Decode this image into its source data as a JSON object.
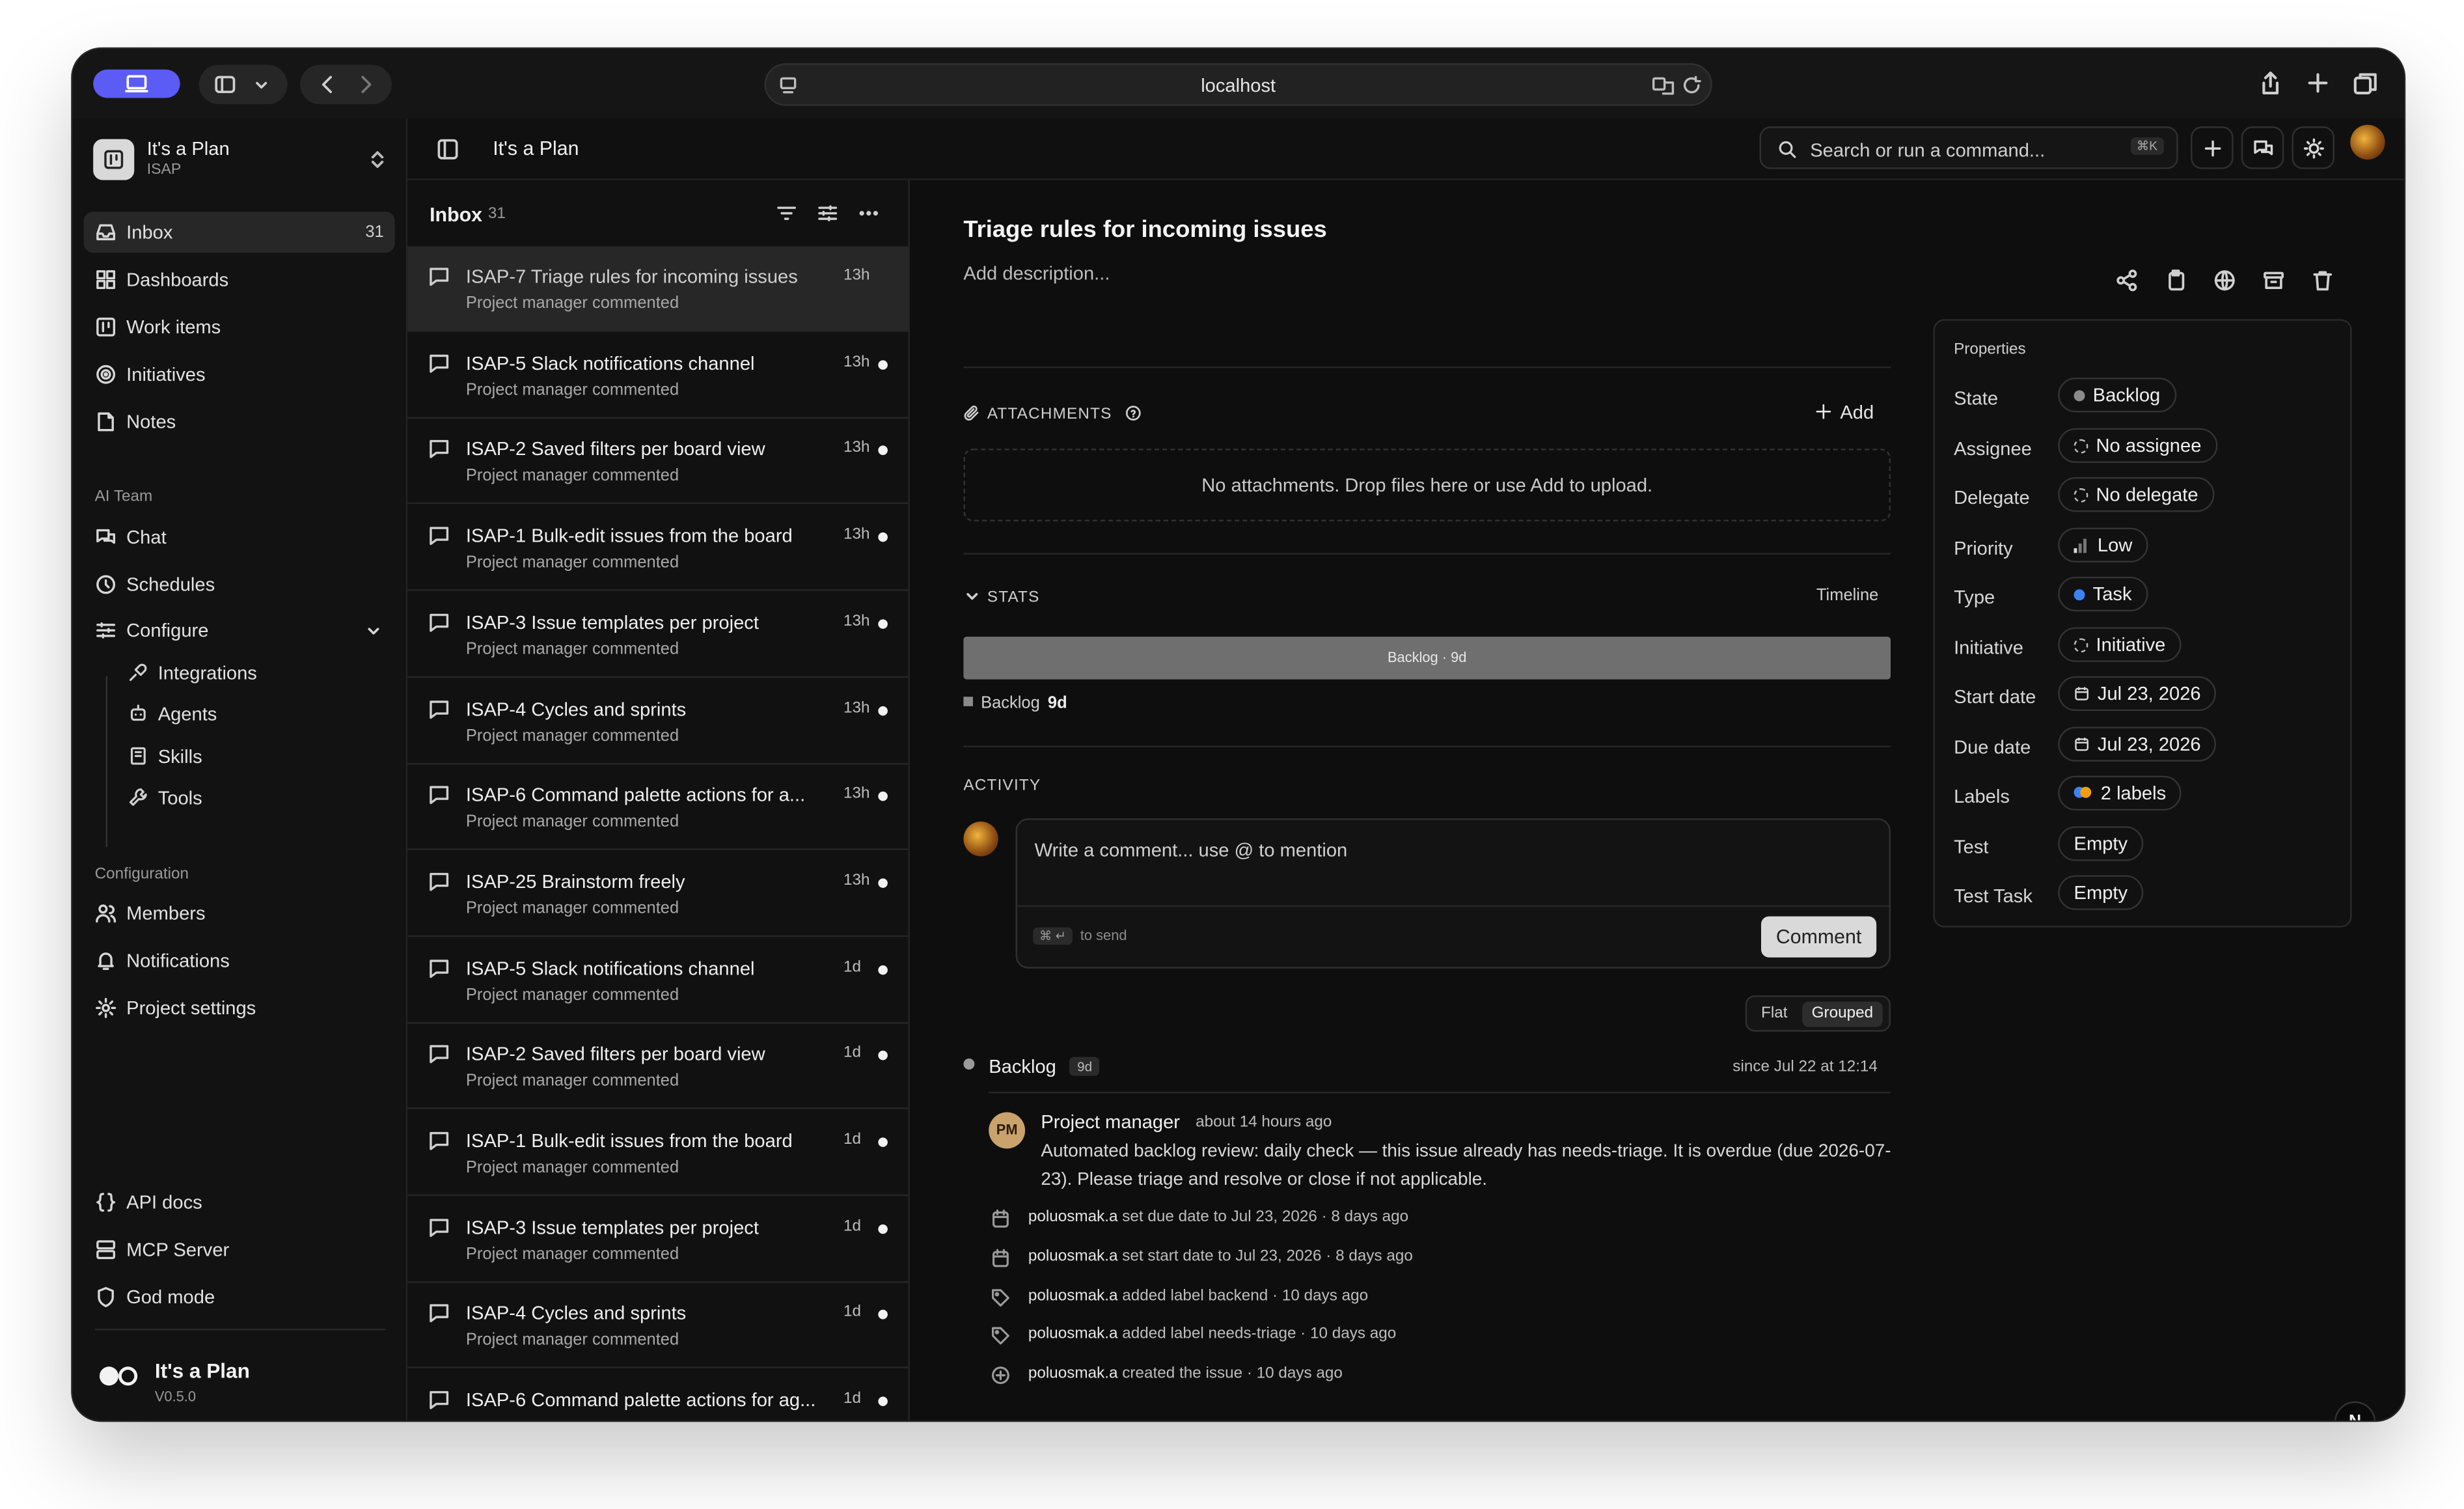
{
  "browser": {
    "url": "localhost"
  },
  "workspace": {
    "name": "It's a Plan",
    "key": "ISAP"
  },
  "sidebar": {
    "main": [
      {
        "label": "Inbox",
        "count": "31",
        "icon": "inbox-icon"
      },
      {
        "label": "Dashboards",
        "icon": "dashboard-icon"
      },
      {
        "label": "Work items",
        "icon": "work-items-icon"
      },
      {
        "label": "Initiatives",
        "icon": "target-icon"
      },
      {
        "label": "Notes",
        "icon": "note-icon"
      }
    ],
    "ai_section": "AI Team",
    "ai": [
      {
        "label": "Chat",
        "icon": "chat-icon"
      },
      {
        "label": "Schedules",
        "icon": "clock-icon"
      },
      {
        "label": "Configure",
        "icon": "sliders-icon"
      }
    ],
    "configure_items": [
      {
        "label": "Integrations",
        "icon": "plug-icon"
      },
      {
        "label": "Agents",
        "icon": "bot-icon"
      },
      {
        "label": "Skills",
        "icon": "book-icon"
      },
      {
        "label": "Tools",
        "icon": "wrench-icon"
      }
    ],
    "config_section": "Configuration",
    "config": [
      {
        "label": "Members",
        "icon": "users-icon"
      },
      {
        "label": "Notifications",
        "icon": "bell-icon"
      },
      {
        "label": "Project settings",
        "icon": "gear-icon"
      }
    ],
    "bottom": [
      {
        "label": "API docs",
        "icon": "braces-icon"
      },
      {
        "label": "MCP Server",
        "icon": "server-icon"
      },
      {
        "label": "God mode",
        "icon": "shield-icon"
      }
    ],
    "brand_name": "It's a Plan",
    "version": "V0.5.0"
  },
  "topbar": {
    "title": "It's a Plan",
    "search_placeholder": "Search or run a command...",
    "search_shortcut": "⌘K"
  },
  "inbox": {
    "title": "Inbox",
    "count": "31",
    "items": [
      {
        "title": "ISAP-7 Triage rules for incoming issues",
        "subtitle": "Project manager commented",
        "time": "13h",
        "unread": false,
        "selected": true
      },
      {
        "title": "ISAP-5 Slack notifications channel",
        "subtitle": "Project manager commented",
        "time": "13h",
        "unread": true
      },
      {
        "title": "ISAP-2 Saved filters per board view",
        "subtitle": "Project manager commented",
        "time": "13h",
        "unread": true
      },
      {
        "title": "ISAP-1 Bulk-edit issues from the board",
        "subtitle": "Project manager commented",
        "time": "13h",
        "unread": true
      },
      {
        "title": "ISAP-3 Issue templates per project",
        "subtitle": "Project manager commented",
        "time": "13h",
        "unread": true
      },
      {
        "title": "ISAP-4 Cycles and sprints",
        "subtitle": "Project manager commented",
        "time": "13h",
        "unread": true
      },
      {
        "title": "ISAP-6 Command palette actions for a...",
        "subtitle": "Project manager commented",
        "time": "13h",
        "unread": true
      },
      {
        "title": "ISAP-25 Brainstorm freely",
        "subtitle": "Project manager commented",
        "time": "13h",
        "unread": true
      },
      {
        "title": "ISAP-5 Slack notifications channel",
        "subtitle": "Project manager commented",
        "time": "1d",
        "unread": true
      },
      {
        "title": "ISAP-2 Saved filters per board view",
        "subtitle": "Project manager commented",
        "time": "1d",
        "unread": true
      },
      {
        "title": "ISAP-1 Bulk-edit issues from the board",
        "subtitle": "Project manager commented",
        "time": "1d",
        "unread": true
      },
      {
        "title": "ISAP-3 Issue templates per project",
        "subtitle": "Project manager commented",
        "time": "1d",
        "unread": true
      },
      {
        "title": "ISAP-4 Cycles and sprints",
        "subtitle": "Project manager commented",
        "time": "1d",
        "unread": true
      },
      {
        "title": "ISAP-6 Command palette actions for ag...",
        "subtitle": "",
        "time": "1d",
        "unread": true
      }
    ]
  },
  "issue": {
    "title": "Triage rules for incoming issues",
    "description_placeholder": "Add description...",
    "attachments_label": "ATTACHMENTS",
    "add_label": "Add",
    "attachments_empty": "No attachments. Drop files here or use Add to upload.",
    "stats_label": "STATS",
    "timeline_label": "Timeline",
    "stat_bar_label": "Backlog · 9d",
    "stat_legend_state": "Backlog",
    "stat_legend_duration": "9d",
    "stat_color": "#6f6f6f",
    "activity_label": "ACTIVITY",
    "comment_placeholder": "Write a comment... use @ to mention",
    "send_hint_keys": "⌘ ↵",
    "send_hint": "to send",
    "comment_button": "Comment",
    "view_flat": "Flat",
    "view_grouped": "Grouped",
    "group_state": "Backlog",
    "group_duration": "9d",
    "group_since": "since Jul 22 at 12:14",
    "comment": {
      "initials": "PM",
      "author": "Project manager",
      "time": "about 14 hours ago",
      "text": "Automated backlog review: daily check — this issue already has needs-triage. It is overdue (due 2026-07-23). Please triage and resolve or close if not applicable."
    },
    "events": [
      {
        "icon": "calendar-icon",
        "user": "poluosmak.a",
        "text": "set due date to Jul 23, 2026 · 8 days ago"
      },
      {
        "icon": "calendar-icon",
        "user": "poluosmak.a",
        "text": "set start date to Jul 23, 2026 · 8 days ago"
      },
      {
        "icon": "tag-icon",
        "user": "poluosmak.a",
        "text": "added label backend · 10 days ago"
      },
      {
        "icon": "tag-icon",
        "user": "poluosmak.a",
        "text": "added label needs-triage · 10 days ago"
      },
      {
        "icon": "plus-circle-icon",
        "user": "poluosmak.a",
        "text": "created the issue · 10 days ago"
      }
    ]
  },
  "properties": {
    "title": "Properties",
    "rows": [
      {
        "label": "State",
        "value": "Backlog",
        "marker": "dot",
        "color": "#8a8a8a"
      },
      {
        "label": "Assignee",
        "value": "No assignee",
        "marker": "ring"
      },
      {
        "label": "Delegate",
        "value": "No delegate",
        "marker": "ring"
      },
      {
        "label": "Priority",
        "value": "Low",
        "marker": "bars"
      },
      {
        "label": "Type",
        "value": "Task",
        "marker": "dot",
        "color": "#3b82f6"
      },
      {
        "label": "Initiative",
        "value": "Initiative",
        "marker": "ring"
      },
      {
        "label": "Start date",
        "value": "Jul 23, 2026",
        "marker": "calendar"
      },
      {
        "label": "Due date",
        "value": "Jul 23, 2026",
        "marker": "calendar"
      },
      {
        "label": "Labels",
        "value": "2 labels",
        "marker": "labels",
        "colors": [
          "#3b82f6",
          "#f59e0b"
        ]
      },
      {
        "label": "Test",
        "value": "Empty",
        "marker": "none"
      },
      {
        "label": "Test Task",
        "value": "Empty",
        "marker": "none"
      }
    ]
  },
  "fab_label": "N",
  "accent": "#5b5bf5"
}
